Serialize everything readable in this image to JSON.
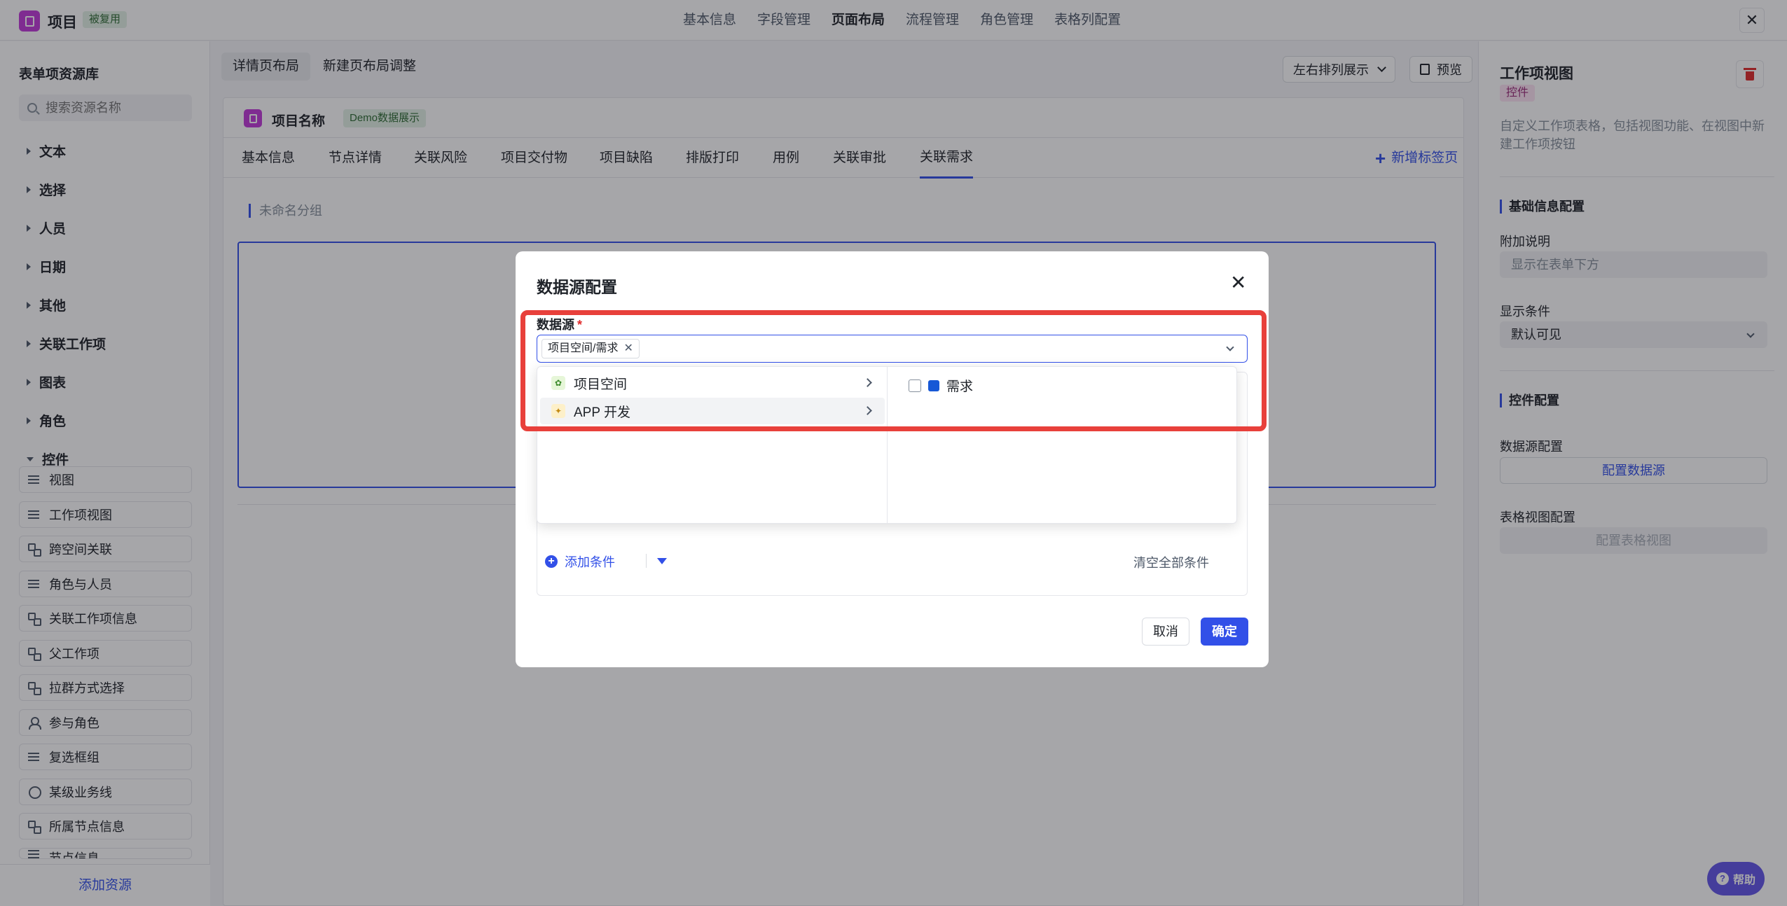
{
  "header": {
    "title": "项目",
    "badge": "被复用",
    "nav": [
      "基本信息",
      "字段管理",
      "页面布局",
      "流程管理",
      "角色管理",
      "表格列配置"
    ],
    "active_nav": "页面布局"
  },
  "sidebar": {
    "title": "表单项资源库",
    "search_placeholder": "搜索资源名称",
    "categories": [
      "文本",
      "选择",
      "人员",
      "日期",
      "其他",
      "关联工作项",
      "图表",
      "角色",
      "控件"
    ],
    "resources": [
      "视图",
      "工作项视图",
      "跨空间关联",
      "角色与人员",
      "关联工作项信息",
      "父工作项",
      "拉群方式选择",
      "参与角色",
      "复选框组",
      "某级业务线",
      "所属节点信息",
      "节点信息"
    ],
    "add_resource": "添加资源"
  },
  "main": {
    "tabs": [
      "详情页布局",
      "新建页布局调整"
    ],
    "layout_select": "左右排列展示",
    "preview": "预览",
    "project_name": "项目名称",
    "demo_badge": "Demo数据展示",
    "subtabs": [
      "基本信息",
      "节点详情",
      "关联风险",
      "项目交付物",
      "项目缺陷",
      "排版打印",
      "用例",
      "关联审批",
      "关联需求"
    ],
    "active_subtab": "关联需求",
    "new_tab": "新增标签页",
    "group_title": "未命名分组"
  },
  "right_panel": {
    "title": "工作项视图",
    "badge": "控件",
    "description": "自定义工作项表格，包括视图功能、在视图中新建工作项按钮",
    "basic_section": "基础信息配置",
    "note_label": "附加说明",
    "note_placeholder": "显示在表单下方",
    "cond_label": "显示条件",
    "cond_value": "默认可见",
    "control_section": "控件配置",
    "ds_label": "数据源配置",
    "ds_button": "配置数据源",
    "table_label": "表格视图配置",
    "table_button": "配置表格视图"
  },
  "modal": {
    "title": "数据源配置",
    "ds_label": "数据源",
    "required_mark": "*",
    "selected_tag": "项目空间/需求",
    "cascader": {
      "level1": [
        "项目空间",
        "APP 开发"
      ],
      "level2": [
        "需求"
      ]
    },
    "add_condition": "添加条件",
    "clear_all": "清空全部条件",
    "cancel": "取消",
    "ok": "确定"
  },
  "help": "帮助",
  "colors": {
    "primary": "#3250e8",
    "highlight": "#e8403b",
    "brand": "#c13bd8"
  }
}
